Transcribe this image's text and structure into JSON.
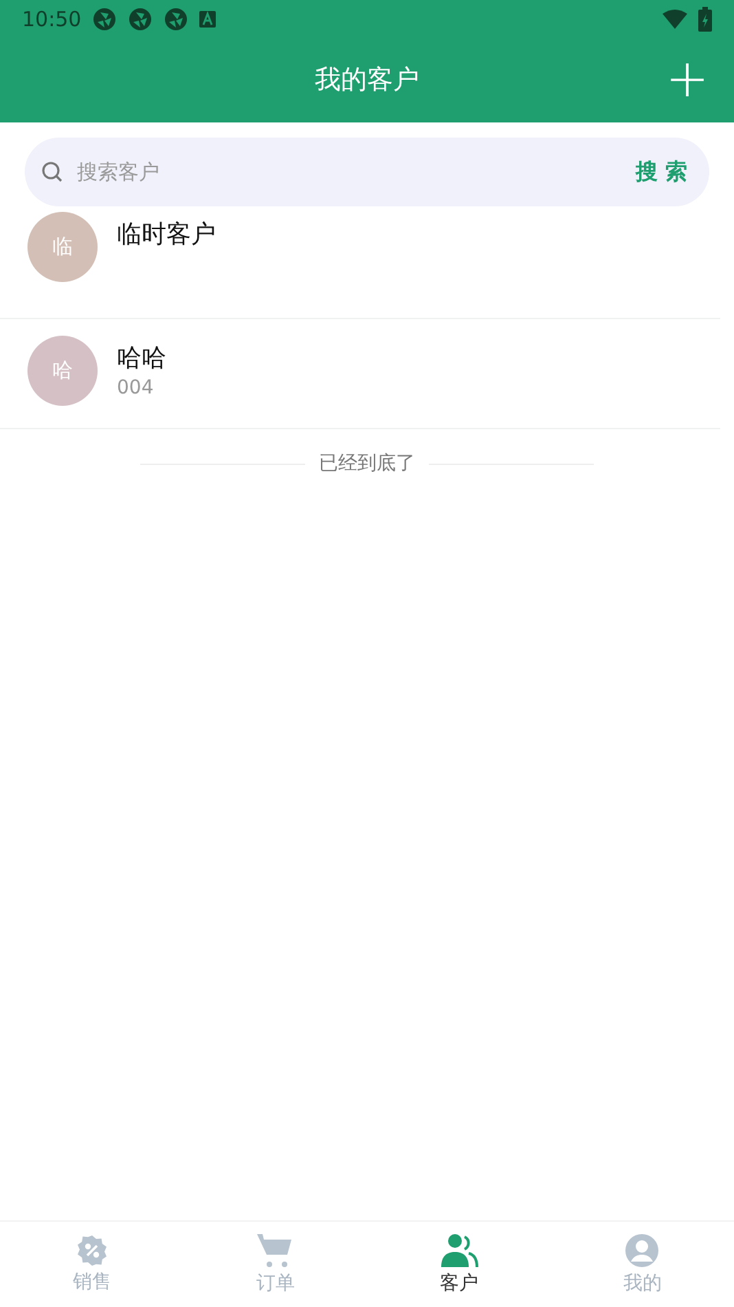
{
  "status_bar": {
    "time": "10:50"
  },
  "header": {
    "title": "我的客户",
    "action": "+"
  },
  "search": {
    "placeholder": "搜索客户",
    "button": "搜 索"
  },
  "customers": [
    {
      "avatar": "临",
      "color": "#d3bfb5",
      "name": "临时客户"
    },
    {
      "avatar": "哈",
      "color": "#d4c0c5",
      "name": "哈哈",
      "code": "004"
    }
  ],
  "end_text": "已经到底了",
  "tabs": [
    {
      "kind": "sale",
      "label": "销售",
      "selected": false
    },
    {
      "kind": "cart",
      "label": "订单",
      "selected": false
    },
    {
      "kind": "customer",
      "label": "客户",
      "selected": true
    },
    {
      "kind": "me",
      "label": "我的",
      "selected": false
    }
  ]
}
